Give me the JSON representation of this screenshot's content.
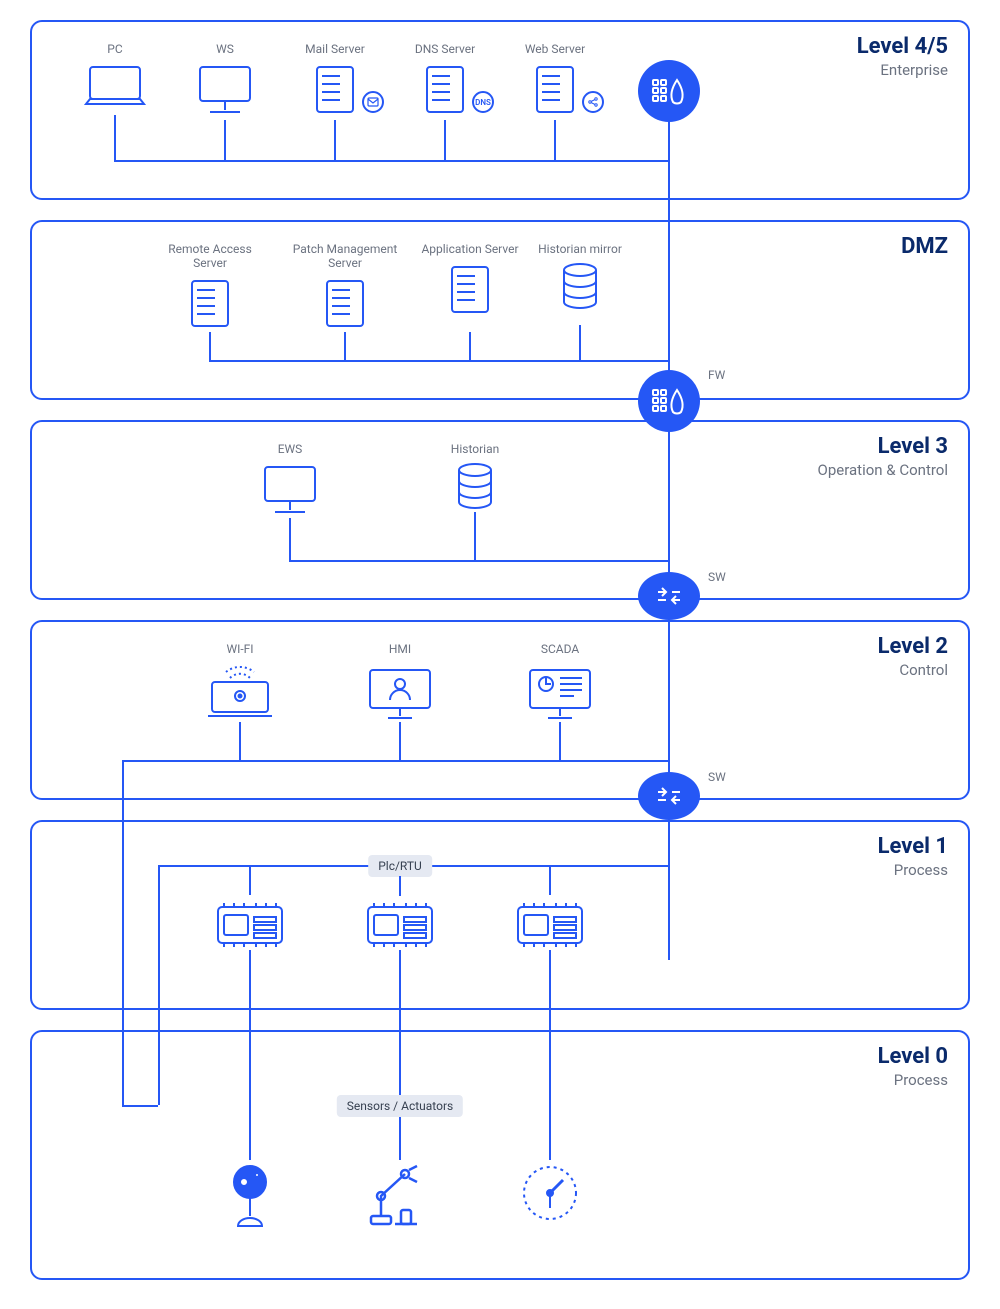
{
  "levels": {
    "l45": {
      "title": "Level 4/5",
      "subtitle": "Enterprise"
    },
    "dmz": {
      "title": "DMZ",
      "subtitle": ""
    },
    "l3": {
      "title": "Level 3",
      "subtitle": "Operation & Control"
    },
    "l2": {
      "title": "Level 2",
      "subtitle": "Control"
    },
    "l1": {
      "title": "Level 1",
      "subtitle": "Process"
    },
    "l0": {
      "title": "Level 0",
      "subtitle": "Process"
    }
  },
  "nodes": {
    "pc": "PC",
    "ws": "WS",
    "mail": "Mail Server",
    "dns": "DNS Server",
    "web": "Web Server",
    "dns_badge": "DNS",
    "ras": "Remote Access Server",
    "pms": "Patch Management Server",
    "app": "Application Server",
    "hmirror": "Historian mirror",
    "ews": "EWS",
    "historian": "Historian",
    "wifi": "WI-FI",
    "hmi": "HMI",
    "scada": "SCADA",
    "plc_tag": "Plc/RTU",
    "sensors_tag": "Sensors / Actuators"
  },
  "round": {
    "fw": "FW",
    "sw": "SW"
  }
}
